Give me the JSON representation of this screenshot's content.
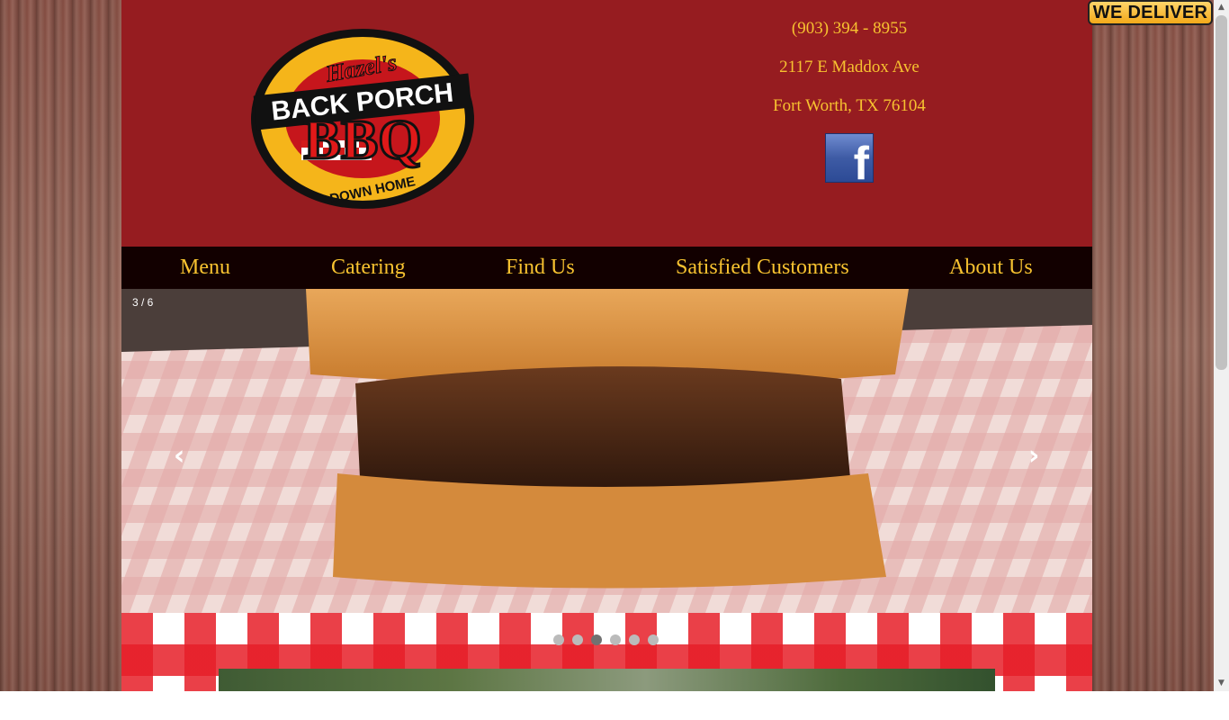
{
  "header": {
    "logo_text_top": "Hazel's",
    "logo_text_middle": "BACK PORCH",
    "logo_text_main": "BBQ",
    "logo_text_bottom": "DOWN HOME",
    "phone": "(903) 394 - 8955",
    "address_line1": "2117 E Maddox Ave",
    "address_line2": "Fort Worth, TX 76104",
    "social_icon": "facebook-icon"
  },
  "nav": {
    "items": [
      {
        "label": "Menu"
      },
      {
        "label": "Catering"
      },
      {
        "label": "Find Us"
      },
      {
        "label": "Satisfied Customers"
      },
      {
        "label": "About Us"
      }
    ]
  },
  "slider": {
    "counter": "3 / 6",
    "prev": "‹",
    "next": "›",
    "current_index": 3,
    "total": 6
  },
  "badge": {
    "label": "WE DELIVER"
  },
  "colors": {
    "header_bg": "#961c20",
    "nav_bg": "#120000",
    "accent_text": "#f7c230",
    "gingham_red": "#e61e28"
  }
}
